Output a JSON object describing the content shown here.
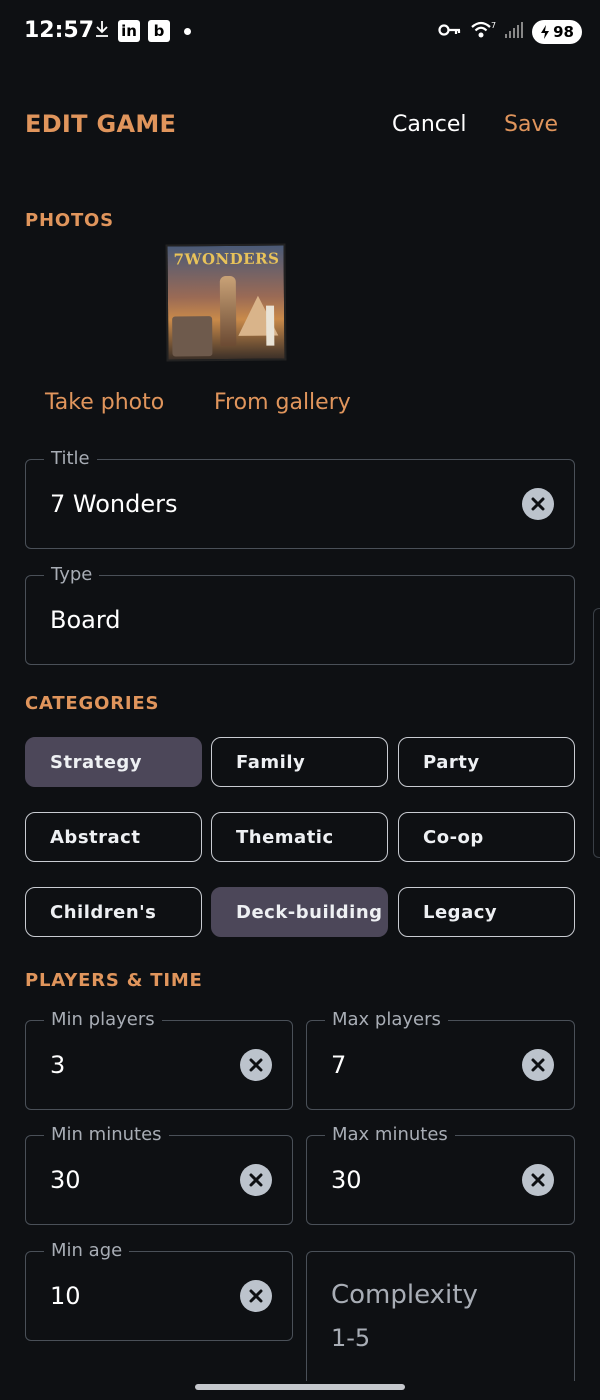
{
  "status_bar": {
    "time": "12:57",
    "battery": "98",
    "icons": [
      "download-icon",
      "linkedin-icon",
      "b-app-icon",
      "dot-icon",
      "vpn-key-icon",
      "wifi-icon",
      "signal-icon",
      "battery-icon"
    ],
    "linkedin_text": "in",
    "b_text": "b"
  },
  "header": {
    "title": "EDIT GAME",
    "cancel_label": "Cancel",
    "save_label": "Save"
  },
  "photos": {
    "section_label": "PHOTOS",
    "photo_logo": "7WONDERS",
    "take_photo_label": "Take photo",
    "from_gallery_label": "From gallery"
  },
  "title_field": {
    "label": "Title",
    "value": "7 Wonders"
  },
  "type_field": {
    "label": "Type",
    "value": "Board"
  },
  "categories": {
    "section_label": "CATEGORIES",
    "items": [
      {
        "label": "Strategy",
        "selected": true
      },
      {
        "label": "Family",
        "selected": false
      },
      {
        "label": "Party",
        "selected": false
      },
      {
        "label": "Abstract",
        "selected": false
      },
      {
        "label": "Thematic",
        "selected": false
      },
      {
        "label": "Co-op",
        "selected": false
      },
      {
        "label": "Children's",
        "selected": false
      },
      {
        "label": "Deck-building",
        "selected": true
      },
      {
        "label": "Legacy",
        "selected": false
      }
    ]
  },
  "players_time": {
    "section_label": "PLAYERS & TIME",
    "min_players": {
      "label": "Min players",
      "value": "3"
    },
    "max_players": {
      "label": "Max players",
      "value": "7"
    },
    "min_minutes": {
      "label": "Min minutes",
      "value": "30"
    },
    "max_minutes": {
      "label": "Max minutes",
      "value": "30"
    },
    "min_age": {
      "label": "Min age",
      "value": "10"
    },
    "complexity": {
      "label": "Complexity",
      "placeholder": "1-5"
    }
  },
  "colors": {
    "background": "#0e1013",
    "accent": "#e0955c",
    "chip_selected": "#4c4759",
    "outline": "#4a5058"
  }
}
